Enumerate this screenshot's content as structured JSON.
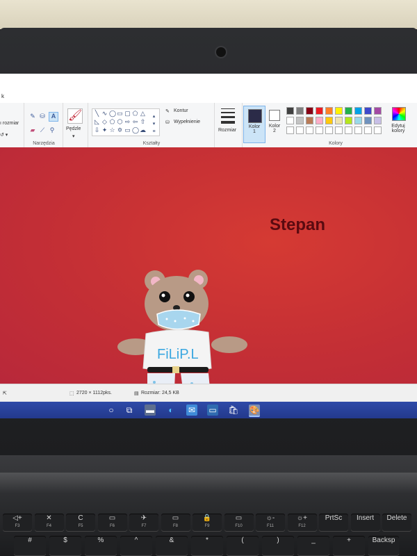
{
  "ribbon": {
    "tab_fragment": "k",
    "size_fragment": "ı rozmiar",
    "tools_label": "Narzędzia",
    "brushes_label": "Pędzle",
    "shapes_label": "Kształty",
    "outline_label": "Kontur",
    "fill_label": "Wypełnienie",
    "size_label": "Rozmiar",
    "color1_label": "Kolor 1",
    "color2_label": "Kolor 2",
    "colors_label": "Kolory",
    "edit_colors_label": "Edytuj kolory",
    "palette_top": [
      "#404040",
      "#7f7f7f",
      "#880015",
      "#ed1c24",
      "#ff7f27",
      "#fff200",
      "#22b14c",
      "#00a2e8",
      "#3f48cc",
      "#a349a4"
    ],
    "palette_mid": [
      "#ffffff",
      "#c3c3c3",
      "#b97a57",
      "#ffaec9",
      "#ffc90e",
      "#efe4b0",
      "#b5e61d",
      "#99d9ea",
      "#7092be",
      "#c8bfe7"
    ],
    "color1": "#2b2b48",
    "color2": "#ffffff"
  },
  "canvas": {
    "name_text": "Stepan",
    "shirt_text": "FiLiP.L",
    "background": "#c8303a"
  },
  "status": {
    "dimensions": "2720 × 1112pks.",
    "filesize": "Rozmiar: 24,5 KB"
  },
  "keyboard": {
    "fn_row": [
      {
        "main": "◁+",
        "sub": "F3"
      },
      {
        "main": "✕",
        "sub": "F4"
      },
      {
        "main": "C",
        "sub": "F5"
      },
      {
        "main": "▭",
        "sub": "F6"
      },
      {
        "main": "✈",
        "sub": "F7"
      },
      {
        "main": "▭",
        "sub": "F8"
      },
      {
        "main": "🔒",
        "sub": "F9"
      },
      {
        "main": "▭",
        "sub": "F10"
      },
      {
        "main": "☼-",
        "sub": "F11"
      },
      {
        "main": "☼+",
        "sub": "F12"
      },
      {
        "main": "PrtSc",
        "sub": ""
      },
      {
        "main": "Insert",
        "sub": ""
      },
      {
        "main": "Delete",
        "sub": ""
      }
    ],
    "num_row": [
      "#",
      "$",
      "%",
      "^",
      "&",
      "*",
      "(",
      ")",
      "_",
      "+",
      "Backsp"
    ]
  }
}
